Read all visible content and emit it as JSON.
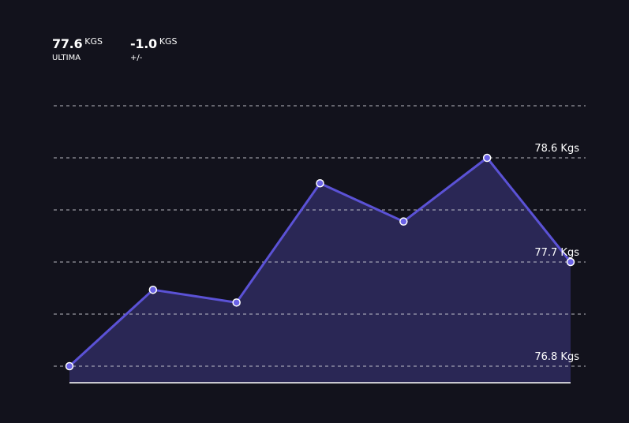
{
  "stats": [
    {
      "value": "77.6",
      "unit": "KGS",
      "label": "ULTIMA"
    },
    {
      "value": "-1.0",
      "unit": "KGS",
      "label": "+/-"
    }
  ],
  "colors": {
    "background": "#12121c",
    "line": "#5b52d6",
    "fill": "#2a2755",
    "point_fill": "#6a62e6",
    "point_stroke": "#ffffff",
    "grid": "#d6d6de",
    "baseline": "#ffffff"
  },
  "chart_data": {
    "type": "area",
    "title": "",
    "xlabel": "",
    "ylabel": "",
    "x": [
      1,
      2,
      3,
      4,
      5,
      6,
      7
    ],
    "values": [
      76.8,
      77.46,
      77.35,
      78.38,
      78.05,
      78.6,
      77.7
    ],
    "ylim": [
      76.8,
      78.6
    ],
    "grid": true,
    "legend": "none",
    "reference_labels": [
      {
        "value": 78.6,
        "label": "78.6 Kgs"
      },
      {
        "value": 77.7,
        "label": "77.7 Kgs"
      },
      {
        "value": 76.8,
        "label": "76.8 Kgs"
      }
    ]
  }
}
